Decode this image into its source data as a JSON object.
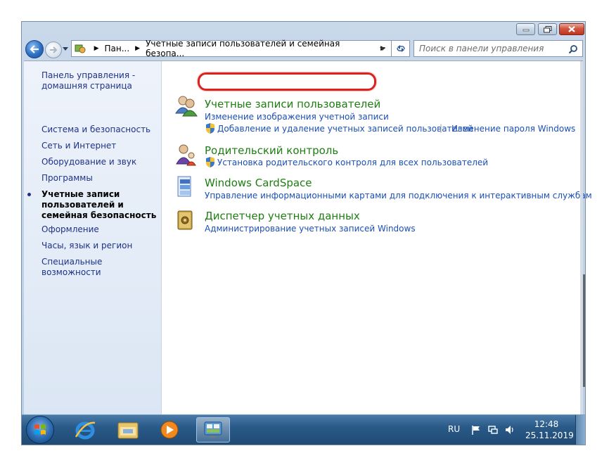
{
  "window": {
    "caption_buttons": [
      "minimize-icon",
      "maximize-icon",
      "close-icon"
    ]
  },
  "address_bar": {
    "crumbs": [
      "Пан...",
      "Учетные записи пользователей и семейная безопа..."
    ]
  },
  "search": {
    "placeholder": "Поиск в панели управления"
  },
  "sidebar": {
    "items": [
      {
        "label": "Панель управления - домашняя страница"
      },
      {
        "label": "Система и безопасность"
      },
      {
        "label": "Сеть и Интернет"
      },
      {
        "label": "Оборудование и звук"
      },
      {
        "label": "Программы"
      },
      {
        "label": "Учетные записи пользователей и семейная безопасность",
        "current": true
      },
      {
        "label": "Оформление"
      },
      {
        "label": "Часы, язык и регион"
      },
      {
        "label": "Специальные возможности"
      }
    ]
  },
  "categories": [
    {
      "title": "Учетные записи пользователей",
      "icon": "user-accounts-icon",
      "links": [
        "Изменение изображения учетной записи",
        "Добавление и удаление учетных записей пользователей",
        "Изменение пароля Windows"
      ]
    },
    {
      "title": "Родительский контроль",
      "icon": "parental-controls-icon",
      "links": [
        "Установка родительского контроля для всех пользователей"
      ]
    },
    {
      "title": "Windows CardSpace",
      "icon": "cardspace-icon",
      "links": [
        "Управление информационными картами для подключения к интерактивным службам"
      ]
    },
    {
      "title": "Диспетчер учетных данных",
      "icon": "credential-manager-icon",
      "links": [
        "Администрирование учетных записей Windows"
      ]
    }
  ],
  "taskbar": {
    "language": "RU",
    "time": "12:48",
    "date": "25.11.2019",
    "colors": {
      "highlight_red": "#e0201a",
      "link_blue": "#1b4fb5",
      "title_green": "#1e7e12"
    }
  }
}
